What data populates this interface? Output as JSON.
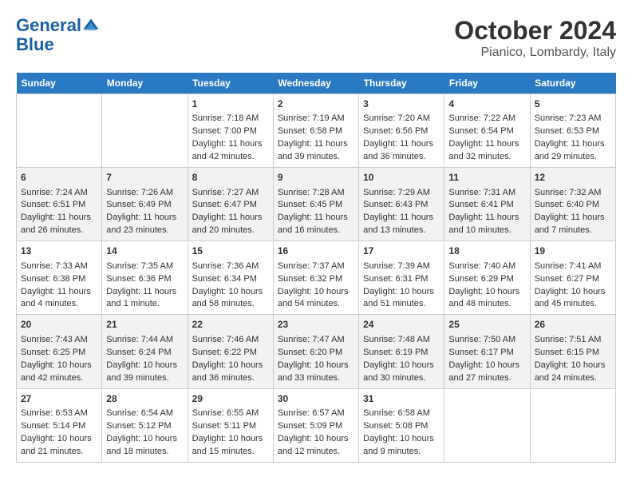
{
  "header": {
    "logo_line1": "General",
    "logo_line2": "Blue",
    "title": "October 2024",
    "subtitle": "Pianico, Lombardy, Italy"
  },
  "calendar": {
    "days_of_week": [
      "Sunday",
      "Monday",
      "Tuesday",
      "Wednesday",
      "Thursday",
      "Friday",
      "Saturday"
    ],
    "weeks": [
      [
        {
          "day": "",
          "content": ""
        },
        {
          "day": "",
          "content": ""
        },
        {
          "day": "1",
          "content": "Sunrise: 7:18 AM\nSunset: 7:00 PM\nDaylight: 11 hours and 42 minutes."
        },
        {
          "day": "2",
          "content": "Sunrise: 7:19 AM\nSunset: 6:58 PM\nDaylight: 11 hours and 39 minutes."
        },
        {
          "day": "3",
          "content": "Sunrise: 7:20 AM\nSunset: 6:56 PM\nDaylight: 11 hours and 36 minutes."
        },
        {
          "day": "4",
          "content": "Sunrise: 7:22 AM\nSunset: 6:54 PM\nDaylight: 11 hours and 32 minutes."
        },
        {
          "day": "5",
          "content": "Sunrise: 7:23 AM\nSunset: 6:53 PM\nDaylight: 11 hours and 29 minutes."
        }
      ],
      [
        {
          "day": "6",
          "content": "Sunrise: 7:24 AM\nSunset: 6:51 PM\nDaylight: 11 hours and 26 minutes."
        },
        {
          "day": "7",
          "content": "Sunrise: 7:26 AM\nSunset: 6:49 PM\nDaylight: 11 hours and 23 minutes."
        },
        {
          "day": "8",
          "content": "Sunrise: 7:27 AM\nSunset: 6:47 PM\nDaylight: 11 hours and 20 minutes."
        },
        {
          "day": "9",
          "content": "Sunrise: 7:28 AM\nSunset: 6:45 PM\nDaylight: 11 hours and 16 minutes."
        },
        {
          "day": "10",
          "content": "Sunrise: 7:29 AM\nSunset: 6:43 PM\nDaylight: 11 hours and 13 minutes."
        },
        {
          "day": "11",
          "content": "Sunrise: 7:31 AM\nSunset: 6:41 PM\nDaylight: 11 hours and 10 minutes."
        },
        {
          "day": "12",
          "content": "Sunrise: 7:32 AM\nSunset: 6:40 PM\nDaylight: 11 hours and 7 minutes."
        }
      ],
      [
        {
          "day": "13",
          "content": "Sunrise: 7:33 AM\nSunset: 6:38 PM\nDaylight: 11 hours and 4 minutes."
        },
        {
          "day": "14",
          "content": "Sunrise: 7:35 AM\nSunset: 6:36 PM\nDaylight: 11 hours and 1 minute."
        },
        {
          "day": "15",
          "content": "Sunrise: 7:36 AM\nSunset: 6:34 PM\nDaylight: 10 hours and 58 minutes."
        },
        {
          "day": "16",
          "content": "Sunrise: 7:37 AM\nSunset: 6:32 PM\nDaylight: 10 hours and 54 minutes."
        },
        {
          "day": "17",
          "content": "Sunrise: 7:39 AM\nSunset: 6:31 PM\nDaylight: 10 hours and 51 minutes."
        },
        {
          "day": "18",
          "content": "Sunrise: 7:40 AM\nSunset: 6:29 PM\nDaylight: 10 hours and 48 minutes."
        },
        {
          "day": "19",
          "content": "Sunrise: 7:41 AM\nSunset: 6:27 PM\nDaylight: 10 hours and 45 minutes."
        }
      ],
      [
        {
          "day": "20",
          "content": "Sunrise: 7:43 AM\nSunset: 6:25 PM\nDaylight: 10 hours and 42 minutes."
        },
        {
          "day": "21",
          "content": "Sunrise: 7:44 AM\nSunset: 6:24 PM\nDaylight: 10 hours and 39 minutes."
        },
        {
          "day": "22",
          "content": "Sunrise: 7:46 AM\nSunset: 6:22 PM\nDaylight: 10 hours and 36 minutes."
        },
        {
          "day": "23",
          "content": "Sunrise: 7:47 AM\nSunset: 6:20 PM\nDaylight: 10 hours and 33 minutes."
        },
        {
          "day": "24",
          "content": "Sunrise: 7:48 AM\nSunset: 6:19 PM\nDaylight: 10 hours and 30 minutes."
        },
        {
          "day": "25",
          "content": "Sunrise: 7:50 AM\nSunset: 6:17 PM\nDaylight: 10 hours and 27 minutes."
        },
        {
          "day": "26",
          "content": "Sunrise: 7:51 AM\nSunset: 6:15 PM\nDaylight: 10 hours and 24 minutes."
        }
      ],
      [
        {
          "day": "27",
          "content": "Sunrise: 6:53 AM\nSunset: 5:14 PM\nDaylight: 10 hours and 21 minutes."
        },
        {
          "day": "28",
          "content": "Sunrise: 6:54 AM\nSunset: 5:12 PM\nDaylight: 10 hours and 18 minutes."
        },
        {
          "day": "29",
          "content": "Sunrise: 6:55 AM\nSunset: 5:11 PM\nDaylight: 10 hours and 15 minutes."
        },
        {
          "day": "30",
          "content": "Sunrise: 6:57 AM\nSunset: 5:09 PM\nDaylight: 10 hours and 12 minutes."
        },
        {
          "day": "31",
          "content": "Sunrise: 6:58 AM\nSunset: 5:08 PM\nDaylight: 10 hours and 9 minutes."
        },
        {
          "day": "",
          "content": ""
        },
        {
          "day": "",
          "content": ""
        }
      ]
    ]
  }
}
